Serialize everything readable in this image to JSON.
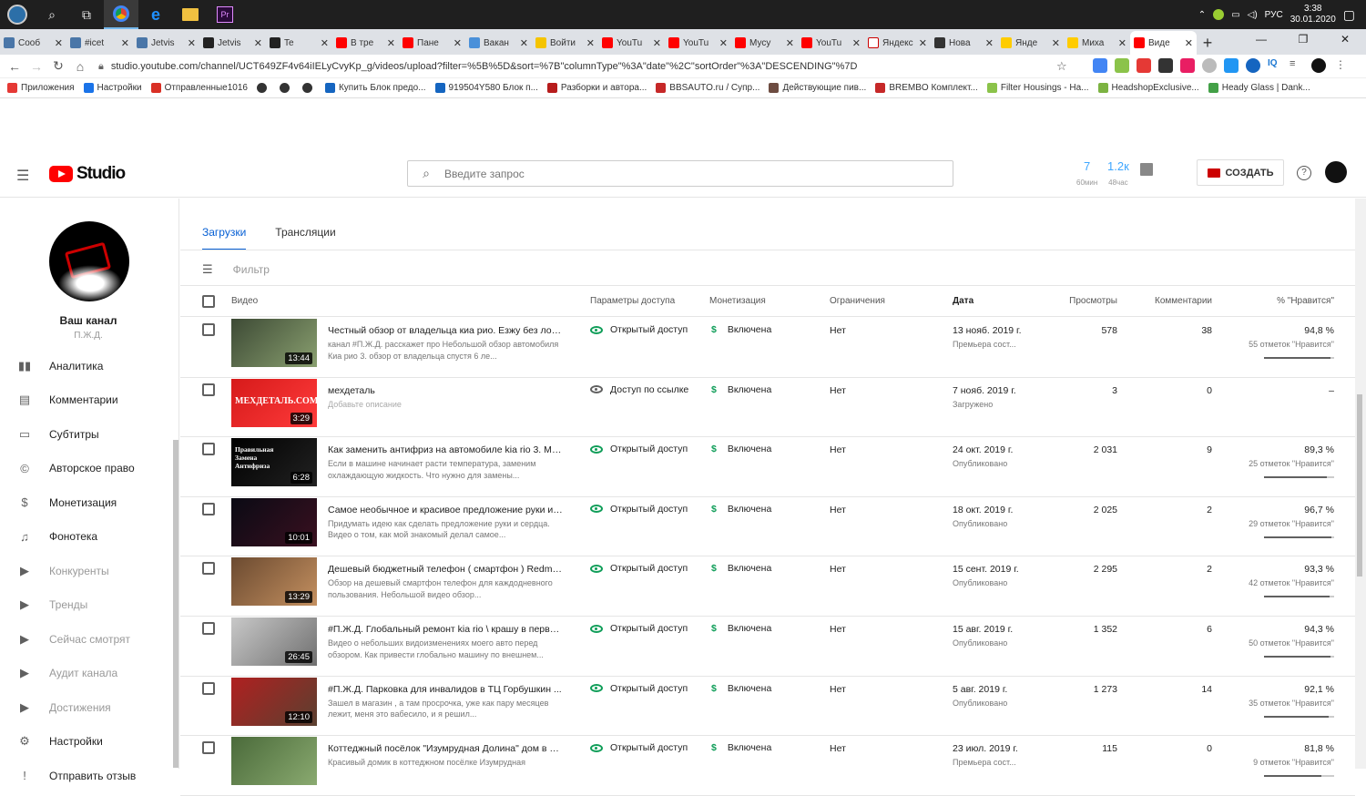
{
  "taskbar": {
    "time": "3:38",
    "date": "30.01.2020",
    "lang": "РУС"
  },
  "tabs": [
    {
      "label": "Сооб",
      "color": "#4a76a8"
    },
    {
      "label": "#icet",
      "color": "#4a76a8"
    },
    {
      "label": "Jetvis",
      "color": "#4a76a8"
    },
    {
      "label": "Jetvis",
      "color": "#222222"
    },
    {
      "label": "Te",
      "color": "#222222"
    },
    {
      "label": "В тре",
      "color": "#ff0000"
    },
    {
      "label": "Пане",
      "color": "#ff0000"
    },
    {
      "label": "Вакан",
      "color": "#4a90d9"
    },
    {
      "label": "Войти",
      "color": "#f5c400"
    },
    {
      "label": "YouTu",
      "color": "#ff0000"
    },
    {
      "label": "YouTu",
      "color": "#ff0000"
    },
    {
      "label": "Мусу",
      "color": "#ff0000"
    },
    {
      "label": "YouTu",
      "color": "#ff0000"
    },
    {
      "label": "Яндекс",
      "color": "#ffffff"
    },
    {
      "label": "Нова",
      "color": "#333333"
    },
    {
      "label": "Янде",
      "color": "#ffcc00"
    },
    {
      "label": "Миха",
      "color": "#ffcc00"
    },
    {
      "label": "Виде",
      "color": "#ff0000"
    }
  ],
  "address": {
    "url": "studio.youtube.com/channel/UCT649ZF4v64iIELyCvyKp_g/videos/upload?filter=%5B%5D&sort=%7B\"columnType\"%3A\"date\"%2C\"sortOrder\"%3A\"DESCENDING\"%7D"
  },
  "bookmarks": [
    {
      "label": "Приложения",
      "color": "#e53935"
    },
    {
      "label": "Настройки",
      "color": "#1a73e8"
    },
    {
      "label": "Отправленные1016",
      "color": "#d93025"
    },
    {
      "label": "",
      "color": "#333333"
    },
    {
      "label": "",
      "color": "#333333"
    },
    {
      "label": "",
      "color": "#333333"
    },
    {
      "label": "Купить Блок предо...",
      "color": "#1565c0"
    },
    {
      "label": "919504Y580 Блок п...",
      "color": "#1565c0"
    },
    {
      "label": "Разборки и автора...",
      "color": "#b71c1c"
    },
    {
      "label": "BBSAUTO.ru / Супр...",
      "color": "#c62828"
    },
    {
      "label": "Действующие пив...",
      "color": "#6d4c41"
    },
    {
      "label": "BREMBO Комплект...",
      "color": "#c62828"
    },
    {
      "label": "Filter Housings - Ha...",
      "color": "#8bc34a"
    },
    {
      "label": "HeadshopExclusive...",
      "color": "#7cb342"
    },
    {
      "label": "Heady Glass | Dank...",
      "color": "#43a047"
    }
  ],
  "header": {
    "logo": "Studio",
    "search_placeholder": "Введите запрос",
    "stat1_value": "7",
    "stat1_label": "60мин",
    "stat2_value": "1.2к",
    "stat2_label": "48час",
    "create_label": "СОЗДАТЬ",
    "help": "?"
  },
  "sidebar": {
    "channel_name": "Ваш канал",
    "channel_sub": "П.Ж.Д.",
    "items": [
      {
        "label": "Аналитика",
        "icon": "▮▮",
        "dim": false
      },
      {
        "label": "Комментарии",
        "icon": "▤",
        "dim": false
      },
      {
        "label": "Субтитры",
        "icon": "▭",
        "dim": false
      },
      {
        "label": "Авторское право",
        "icon": "©",
        "dim": false
      },
      {
        "label": "Монетизация",
        "icon": "$",
        "dim": false
      },
      {
        "label": "Фонотека",
        "icon": "♫",
        "dim": false
      },
      {
        "label": "Конкуренты",
        "icon": "▶",
        "dim": true
      },
      {
        "label": "Тренды",
        "icon": "▶",
        "dim": true
      },
      {
        "label": "Сейчас смотрят",
        "icon": "▶",
        "dim": true
      },
      {
        "label": "Аудит канала",
        "icon": "▶",
        "dim": true
      },
      {
        "label": "Достижения",
        "icon": "▶",
        "dim": true
      },
      {
        "label": "Настройки",
        "icon": "⚙",
        "dim": false
      },
      {
        "label": "Отправить отзыв",
        "icon": "!",
        "dim": false
      }
    ]
  },
  "main": {
    "tabs": [
      "Загрузки",
      "Трансляции"
    ],
    "filter_placeholder": "Фильтр",
    "columns": {
      "video": "Видео",
      "access": "Параметры доступа",
      "monetization": "Монетизация",
      "restrictions": "Ограничения",
      "date": "Дата",
      "views": "Просмотры",
      "comments": "Комментарии",
      "likes": "% \"Нравится\""
    },
    "rows": [
      {
        "duration": "13:44",
        "title": "Честный обзор от владельца киа рио. Езжу без лоб...",
        "description": "канал #П.Ж.Д. расскажет про Небольшой обзор автомобиля Киа рио 3. обзор от владельца спустя 6 ле...",
        "access": "Открытый доступ",
        "access_type": "public",
        "monetization": "Включена",
        "restrictions": "Нет",
        "date": "13 нояб. 2019 г.",
        "status": "Премьера сост...",
        "views": "578",
        "comments": "38",
        "likes": "94,8 %",
        "likes_count": "55 отметок \"Нравится\"",
        "likes_ratio": 0.948,
        "thumb": [
          "#3d4a35",
          "#8aa070"
        ]
      },
      {
        "duration": "3:29",
        "title": "мехдеталь",
        "description": "Добавьте описание",
        "access": "Доступ по ссылке",
        "access_type": "link",
        "monetization": "Включена",
        "restrictions": "Нет",
        "date": "7 нояб. 2019 г.",
        "status": "Загружено",
        "views": "3",
        "comments": "0",
        "likes": "–",
        "likes_count": "",
        "likes_ratio": null,
        "thumb": [
          "#d61a1a",
          "#ff3b3b"
        ],
        "thumb_text": "МЕХДЕТАЛЬ.COM"
      },
      {
        "duration": "6:28",
        "title": "Как заменить антифриз на автомобиле kia rio 3. Ме...",
        "description": "Если в машине начинает расти температура, заменим охлаждающую жидкость. Что нужно для замены...",
        "access": "Открытый доступ",
        "access_type": "public",
        "monetization": "Включена",
        "restrictions": "Нет",
        "date": "24 окт. 2019 г.",
        "status": "Опубликовано",
        "views": "2 031",
        "comments": "9",
        "likes": "89,3 %",
        "likes_count": "25 отметок \"Нравится\"",
        "likes_ratio": 0.893,
        "thumb": [
          "#000000",
          "#222222"
        ],
        "thumb_text": "Правильная Замена Антифриза"
      },
      {
        "duration": "10:01",
        "title": "Самое необычное и красивое предложение руки и ...",
        "description": "Придумать идею как сделать предложение руки и сердца. Видео о том, как мой знакомый делал самое...",
        "access": "Открытый доступ",
        "access_type": "public",
        "monetization": "Включена",
        "restrictions": "Нет",
        "date": "18 окт. 2019 г.",
        "status": "Опубликовано",
        "views": "2 025",
        "comments": "2",
        "likes": "96,7 %",
        "likes_count": "29 отметок \"Нравится\"",
        "likes_ratio": 0.967,
        "thumb": [
          "#0a0a14",
          "#3a1020"
        ]
      },
      {
        "duration": "13:29",
        "title": "Дешевый бюджетный телефон ( смартфон ) Redmi (...",
        "description": "Обзор на дешевый смартфон телефон для каждодневного пользования. Небольшой видео обзор...",
        "access": "Открытый доступ",
        "access_type": "public",
        "monetization": "Включена",
        "restrictions": "Нет",
        "date": "15 сент. 2019 г.",
        "status": "Опубликовано",
        "views": "2 295",
        "comments": "2",
        "likes": "93,3 %",
        "likes_count": "42 отметок \"Нравится\"",
        "likes_ratio": 0.933,
        "thumb": [
          "#6b4a30",
          "#c49060"
        ]
      },
      {
        "duration": "26:45",
        "title": "#П.Ж.Д. Глобальный ремонт kia rio \\ крашу в первы...",
        "description": "Видео о небольших видоизменениях моего авто перед обзором. Как привести глобально машину по внешнем...",
        "access": "Открытый доступ",
        "access_type": "public",
        "monetization": "Включена",
        "restrictions": "Нет",
        "date": "15 авг. 2019 г.",
        "status": "Опубликовано",
        "views": "1 352",
        "comments": "6",
        "likes": "94,3 %",
        "likes_count": "50 отметок \"Нравится\"",
        "likes_ratio": 0.943,
        "thumb": [
          "#c8c8c8",
          "#707070"
        ]
      },
      {
        "duration": "12:10",
        "title": "#П.Ж.Д. Парковка для инвалидов в ТЦ Горбушкин ...",
        "description": "Зашел в магазин , а там просрочка, уже как пару месяцев лежит, меня это вабесило, и я решил...",
        "access": "Открытый доступ",
        "access_type": "public",
        "monetization": "Включена",
        "restrictions": "Нет",
        "date": "5 авг. 2019 г.",
        "status": "Опубликовано",
        "views": "1 273",
        "comments": "14",
        "likes": "92,1 %",
        "likes_count": "35 отметок \"Нравится\"",
        "likes_ratio": 0.921,
        "thumb": [
          "#b02020",
          "#5a4030"
        ]
      },
      {
        "duration": "",
        "title": "Коттеджный посёлок \"Изумрудная Долина\" дом в К...",
        "description": "Красивый домик в коттеджном посёлке Изумрудная",
        "access": "Открытый доступ",
        "access_type": "public",
        "monetization": "Включена",
        "restrictions": "Нет",
        "date": "23 июл. 2019 г.",
        "status": "Премьера сост...",
        "views": "115",
        "comments": "0",
        "likes": "81,8 %",
        "likes_count": "9 отметок \"Нравится\"",
        "likes_ratio": 0.818,
        "thumb": [
          "#4a6a3a",
          "#8aaa70"
        ]
      }
    ]
  }
}
